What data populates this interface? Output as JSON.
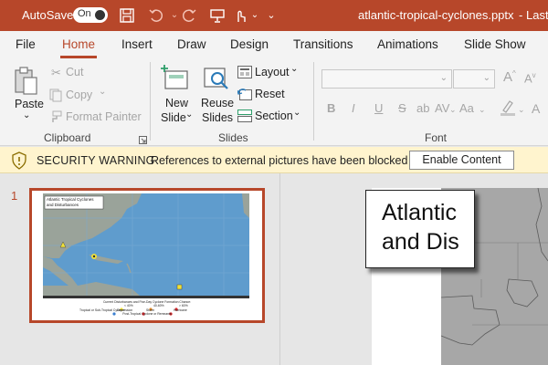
{
  "titlebar": {
    "autosave_label": "AutoSave",
    "autosave_state": "On",
    "icons": [
      "save-icon",
      "undo-icon",
      "redo-icon",
      "present-icon",
      "touch-mode-icon",
      "customize-chevron-icon"
    ],
    "document_name": "atlantic-tropical-cyclones.pptx",
    "separator": "-",
    "last_modified": "Last M",
    "accent_color": "#b7472a"
  },
  "tabs": [
    "File",
    "Home",
    "Insert",
    "Draw",
    "Design",
    "Transitions",
    "Animations",
    "Slide Show"
  ],
  "active_tab": "Home",
  "ribbon": {
    "clipboard": {
      "paste": "Paste",
      "cut": "Cut",
      "copy": "Copy",
      "format_painter": "Format Painter",
      "group_label": "Clipboard"
    },
    "slides": {
      "new_slide": [
        "New",
        "Slide"
      ],
      "reuse_slides": [
        "Reuse",
        "Slides"
      ],
      "layout": "Layout",
      "reset": "Reset",
      "section": "Section",
      "group_label": "Slides"
    },
    "font": {
      "bold": "B",
      "italic": "I",
      "underline": "U",
      "strikethrough": "S",
      "shadow": "ab",
      "spacing": "AV",
      "change_case": "Aa",
      "group_label": "Font"
    }
  },
  "security_bar": {
    "title": "SECURITY WARNING",
    "message": "References to external pictures have been blocked",
    "button": "Enable Content"
  },
  "thumbnails": [
    {
      "number": "1",
      "title": [
        "Atlantic Tropical Cyclones",
        "and Disturbances"
      ],
      "legend": [
        "Current Disturbances and Five-Day Cyclone Formation Chance:",
        "< 40%",
        "40-60%",
        "> 60%",
        "Tropical or Sub-Tropical Cyclone:",
        "Depression",
        "Storm",
        "Hurricane",
        "Post-Tropical Cyclone or Remnants"
      ]
    }
  ],
  "slide": {
    "title_lines": [
      "Atlantic",
      "and Dis"
    ]
  }
}
